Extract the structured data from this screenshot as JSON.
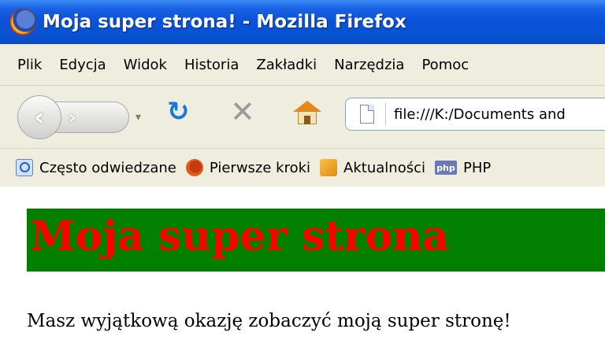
{
  "window": {
    "title": "Moja super strona! - Mozilla Firefox"
  },
  "menu": {
    "items": [
      "Plik",
      "Edycja",
      "Widok",
      "Historia",
      "Zakładki",
      "Narzędzia",
      "Pomoc"
    ]
  },
  "navigation": {
    "url": "file:///K:/Documents and"
  },
  "bookmarks": {
    "items": [
      {
        "label": "Często odwiedzane",
        "icon": "search-icon"
      },
      {
        "label": "Pierwsze kroki",
        "icon": "firefox-icon"
      },
      {
        "label": "Aktualności",
        "icon": "rss-icon"
      },
      {
        "label": "PHP",
        "icon": "php-icon"
      }
    ],
    "php_badge": "php"
  },
  "page": {
    "heading": "Moja super strona",
    "paragraph": "Masz wyjątkową okazję zobaczyć moją super stronę!"
  },
  "colors": {
    "banner_background": "#007f00",
    "heading_text": "#ff0000"
  }
}
